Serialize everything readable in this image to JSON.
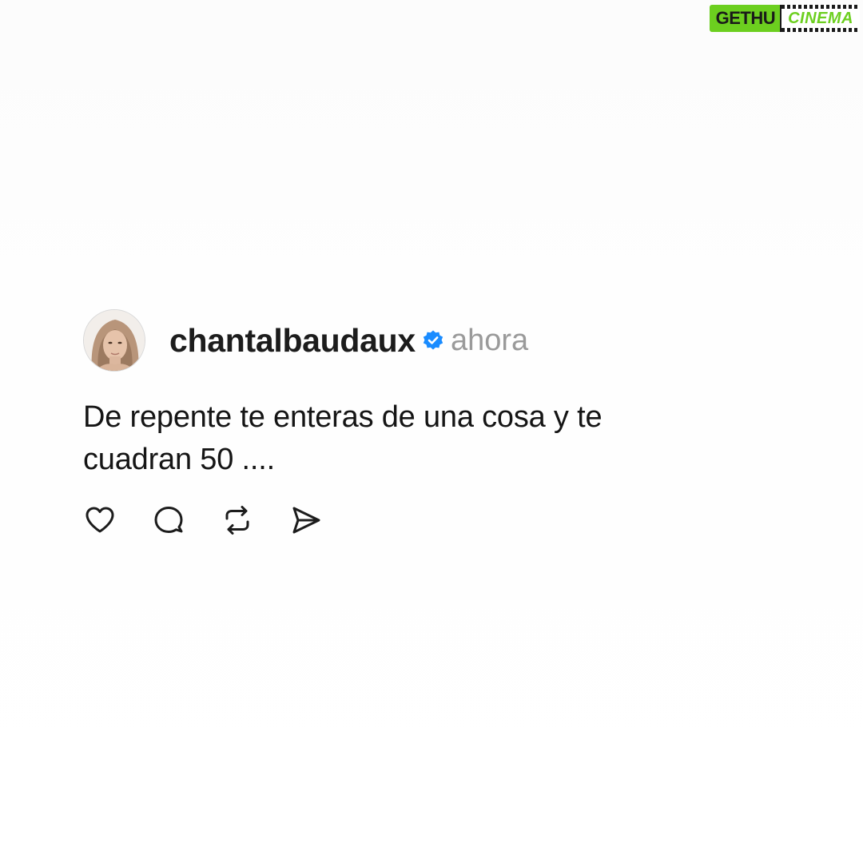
{
  "watermark": {
    "left_text": "GETHU",
    "right_text": "CINEMA",
    "accent_color": "#6ccf1f"
  },
  "post": {
    "username": "chantalbaudaux",
    "verified": true,
    "verified_color": "#1a8cff",
    "timestamp": "ahora",
    "text_line1": "De repente te enteras de una cosa y te",
    "text_line2": "cuadran 50 ...."
  },
  "actions": [
    {
      "icon": "heart-icon"
    },
    {
      "icon": "comment-icon"
    },
    {
      "icon": "repost-icon"
    },
    {
      "icon": "share-icon"
    }
  ]
}
